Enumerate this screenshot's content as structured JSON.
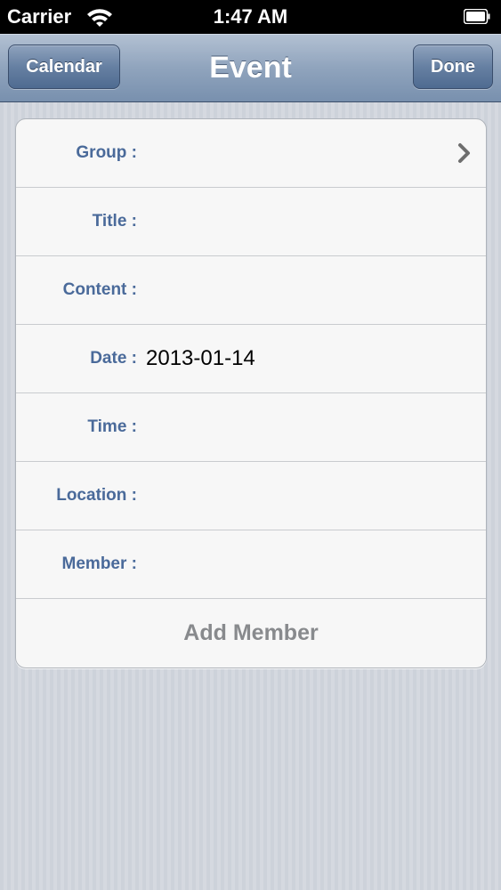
{
  "status_bar": {
    "carrier": "Carrier",
    "time": "1:47 AM"
  },
  "nav": {
    "title": "Event",
    "back_label": "Calendar",
    "done_label": "Done"
  },
  "form": {
    "rows": [
      {
        "label": "Group :",
        "value": ""
      },
      {
        "label": "Title :",
        "value": ""
      },
      {
        "label": "Content :",
        "value": ""
      },
      {
        "label": "Date :",
        "value": "2013-01-14"
      },
      {
        "label": "Time :",
        "value": ""
      },
      {
        "label": "Location :",
        "value": ""
      },
      {
        "label": "Member :",
        "value": ""
      }
    ],
    "add_member_label": "Add Member"
  },
  "icons": {
    "wifi": "wifi-icon",
    "battery": "battery-icon",
    "chevron": "chevron-right-icon"
  },
  "colors": {
    "label": "#4a6a9a",
    "nav_bar": "#90a4bd",
    "add_member": "#888a8d"
  }
}
